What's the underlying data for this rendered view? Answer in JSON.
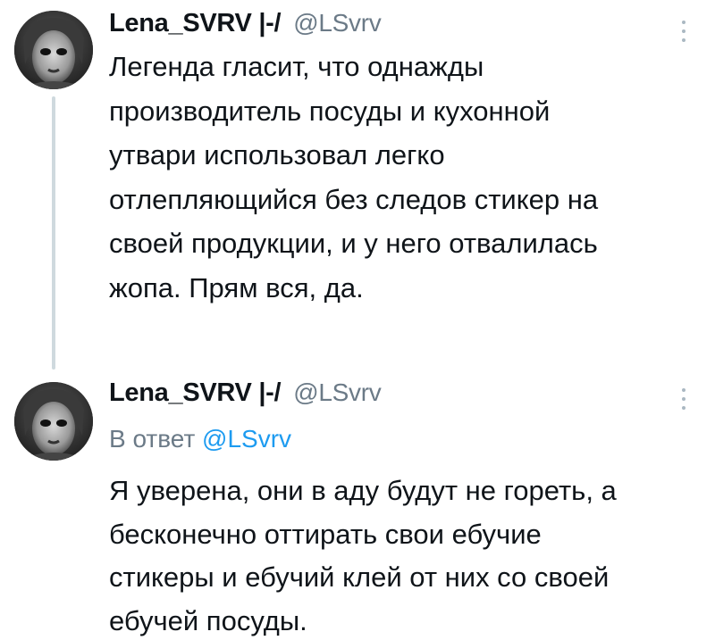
{
  "tweets": [
    {
      "display_name": "Lena_SVRV |-/",
      "handle": "@LSvrv",
      "avatar_icon": "avatar-icon",
      "menu_icon": "more-vertical-icon",
      "text_lines": [
        "Легенда гласит, что однажды",
        "производитель посуды и кухонной",
        "утвари использовал легко",
        "отлепляющийся без следов стикер на",
        "своей продукции, и у него отвалилась",
        "жопа. Прям вся, да."
      ]
    },
    {
      "display_name": "Lena_SVRV |-/",
      "handle": "@LSvrv",
      "avatar_icon": "avatar-icon",
      "menu_icon": "more-vertical-icon",
      "reply_to_prefix": "В ответ",
      "reply_to_handle": "@LSvrv",
      "text_lines": [
        "Я уверена, они в аду будут не гореть, а",
        "бесконечно оттирать свои ебучие",
        "стикеры и ебучий клей от них со своей",
        "ебучей посуды."
      ]
    }
  ],
  "colors": {
    "text": "#0f1419",
    "secondary": "#6b7a87",
    "link": "#1d9bf0",
    "thread_line": "#cfd9de"
  }
}
